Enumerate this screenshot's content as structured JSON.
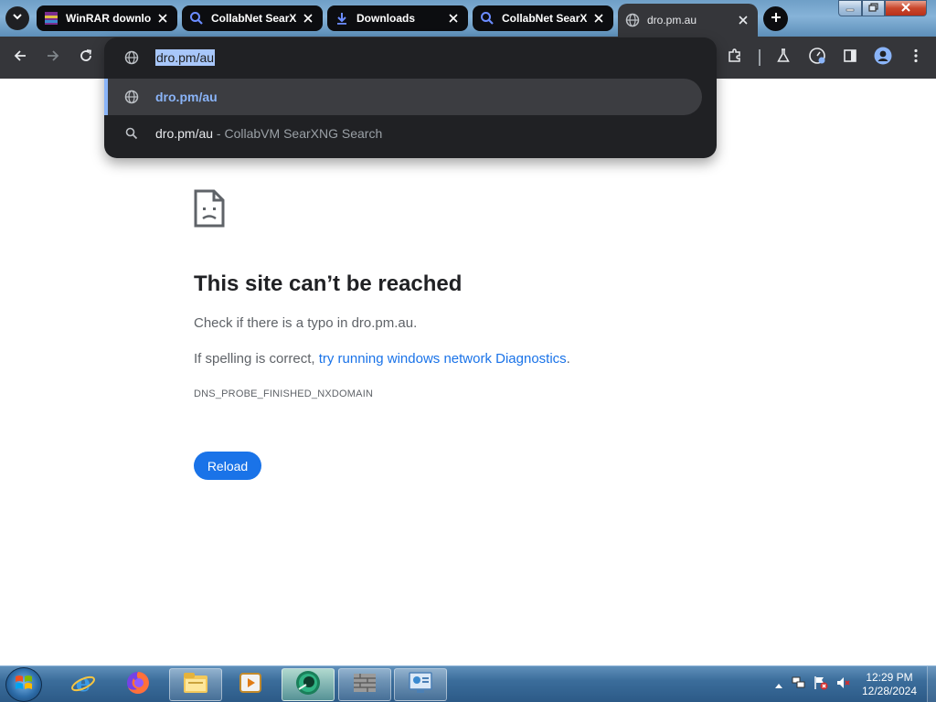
{
  "tabs": [
    {
      "title": "WinRAR downlo",
      "favicon": "winrar-icon"
    },
    {
      "title": "CollabNet SearX",
      "favicon": "search-icon"
    },
    {
      "title": "Downloads",
      "favicon": "download-icon"
    },
    {
      "title": "CollabNet SearX",
      "favicon": "search-icon"
    },
    {
      "title": "dro.pm.au",
      "favicon": "globe-icon",
      "active": true
    }
  ],
  "omnibox": {
    "input_text": "dro.pm/au",
    "suggestions": [
      {
        "text": "dro.pm/au",
        "type": "url"
      },
      {
        "text": "dro.pm/au",
        "suffix": " - CollabVM SearXNG Search",
        "type": "search"
      }
    ]
  },
  "error_page": {
    "title": "This site can’t be reached",
    "line1": "Check if there is a typo in dro.pm.au.",
    "line2_prefix": "If spelling is correct, ",
    "line2_link": "try running windows network Diagnostics",
    "line2_suffix": ".",
    "error_code": "DNS_PROBE_FINISHED_NXDOMAIN",
    "reload_label": "Reload"
  },
  "taskbar": {
    "apps": [
      "internet-explorer-icon",
      "firefox-icon",
      "file-explorer-icon",
      "media-player-icon",
      "chrome-canary-icon",
      "firewall-icon",
      "control-panel-icon"
    ],
    "clock_time": "12:29 PM",
    "clock_date": "12/28/2024"
  },
  "colors": {
    "toolbar_bg": "#35363a",
    "omnibox_bg": "#202124",
    "link": "#1a73e8",
    "accent": "#8ab4f8"
  }
}
